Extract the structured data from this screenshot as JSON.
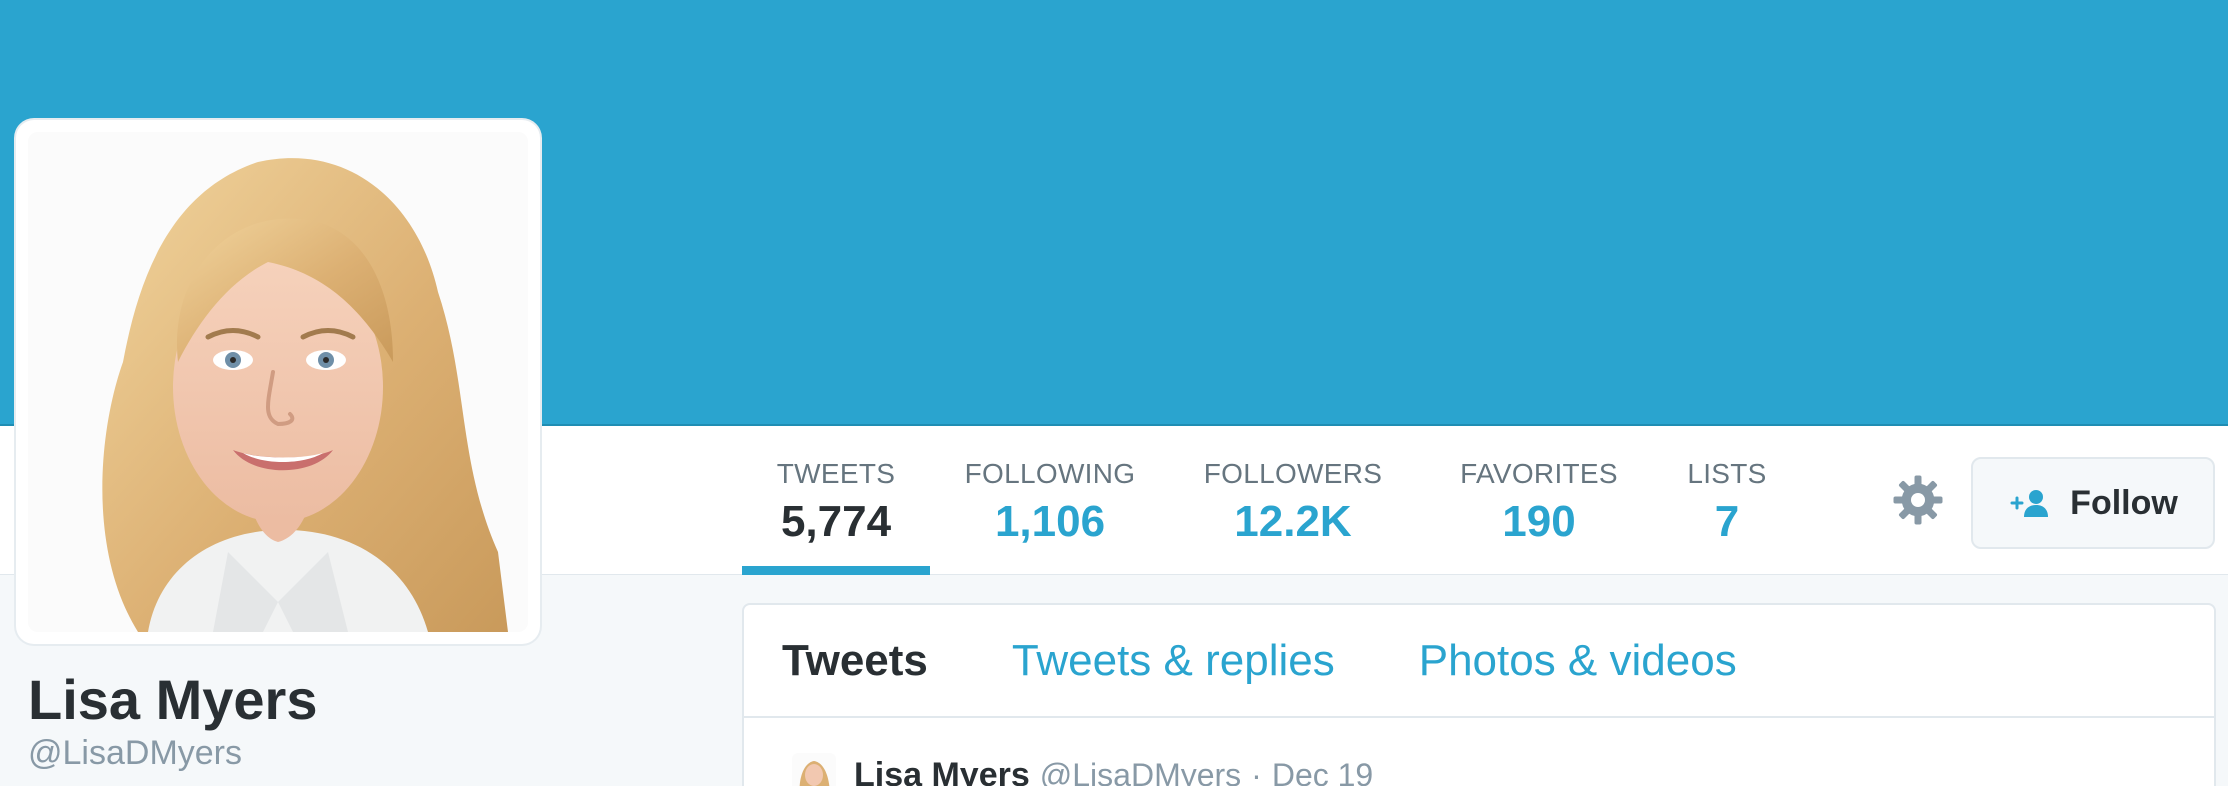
{
  "profile": {
    "name": "Lisa Myers",
    "handle": "@LisaDMyers"
  },
  "stats": {
    "tweets": {
      "label": "TWEETS",
      "value": "5,774"
    },
    "following": {
      "label": "FOLLOWING",
      "value": "1,106"
    },
    "followers": {
      "label": "FOLLOWERS",
      "value": "12.2K"
    },
    "favorites": {
      "label": "FAVORITES",
      "value": "190"
    },
    "lists": {
      "label": "LISTS",
      "value": "7"
    }
  },
  "actions": {
    "settings_icon": "gear-icon",
    "follow_icon": "add-user-icon",
    "follow_label": "Follow"
  },
  "timeline": {
    "tabs": [
      {
        "label": "Tweets",
        "active": true
      },
      {
        "label": "Tweets & replies",
        "active": false
      },
      {
        "label": "Photos & videos",
        "active": false
      }
    ],
    "first_tweet": {
      "name": "Lisa Myers",
      "handle": "@LisaDMyers",
      "separator": "·",
      "date": "Dec 19"
    }
  },
  "colors": {
    "brand": "#2aa4cf",
    "text": "#292f33",
    "muted": "#8899a6",
    "border": "#e1e8ed",
    "background": "#f5f8fa"
  }
}
